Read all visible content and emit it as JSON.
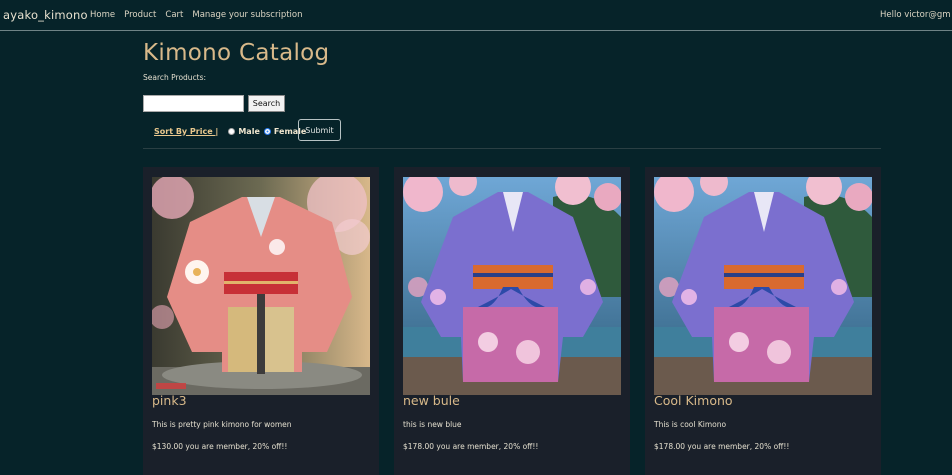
{
  "nav": {
    "brand": "ayako_kimono",
    "links": [
      "Home",
      "Product",
      "Cart",
      "Manage your subscription"
    ],
    "greeting": "Hello victor@gm"
  },
  "main": {
    "title": "Kimono Catalog",
    "search_label": "Search Products:",
    "search_value": "",
    "search_button": "Search",
    "sort_label": "Sort By Price |",
    "radio_male": "Male",
    "radio_female": "Female",
    "selected_gender": "Female",
    "submit_button": "Submit"
  },
  "products": [
    {
      "name": "pink3",
      "description": "This is pretty pink kimono for women",
      "price_text": "$130.00 you are member, 20% off!!"
    },
    {
      "name": "new bule",
      "description": "this is new blue",
      "price_text": "$178.00 you are member, 20% off!!"
    },
    {
      "name": "Cool Kimono",
      "description": "This is cool Kimono",
      "price_text": "$178.00 you are member, 20% off!!"
    }
  ],
  "colors": {
    "background": "#062329",
    "title": "#d8b98a",
    "card": "#1a202a",
    "sort_link": "#e9c88e"
  }
}
